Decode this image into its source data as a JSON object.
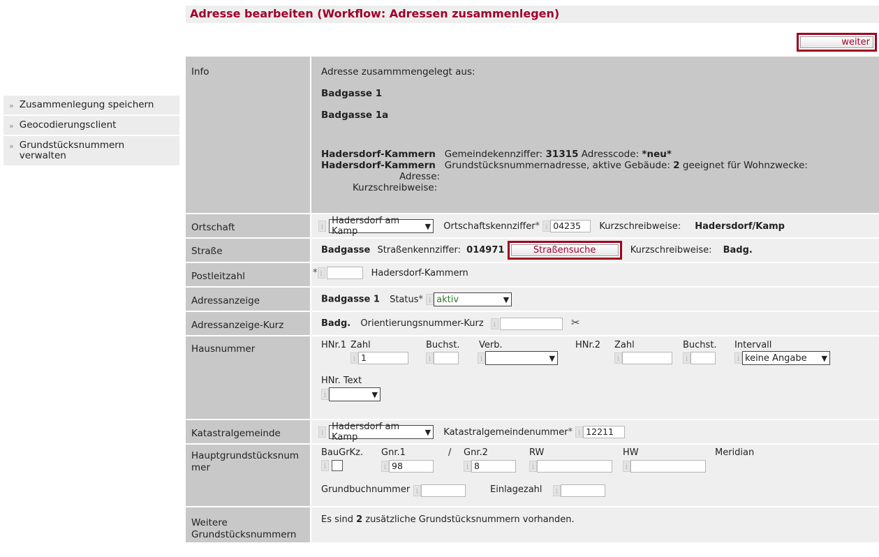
{
  "sidebar": {
    "items": [
      {
        "label": "Zusammenlegung speichern"
      },
      {
        "label": "Geocodierungsclient"
      },
      {
        "label": "Grundstücksnummern verwalten"
      }
    ]
  },
  "title": "Adresse bearbeiten (Workflow: Adressen zusammenlegen)",
  "weiter_label": "weiter",
  "info": {
    "label": "Info",
    "merged_from": "Adresse zusammmengelegt aus:",
    "addr1": "Badgasse 1",
    "addr2": "Badgasse 1a",
    "line1_name": "Hadersdorf-Kammern",
    "line1_text1": "Gemeindekennziffer:",
    "line1_code": "31315",
    "line1_text2": "Adresscode:",
    "line1_adresscode": "*neu*",
    "line2_name": "Hadersdorf-Kammern",
    "line2_text1": "Grundstücksnummernadresse, aktive Gebäude:",
    "line2_count": "2",
    "line2_text2": "geeignet für Wohnzwecke:",
    "adresse_label": "Adresse:",
    "kurz_label": "Kurzschreibweise:"
  },
  "ortschaft": {
    "label": "Ortschaft",
    "select": "Hadersdorf am Kamp",
    "kennziffer_label": "Ortschaftskennziffer",
    "kennziffer_value": "04235",
    "kurz_label": "Kurzschreibweise:",
    "kurz_value": "Hadersdorf/Kamp"
  },
  "strasse": {
    "label": "Straße",
    "name": "Badgasse",
    "kennziffer_label": "Straßenkennziffer:",
    "kennziffer_value": "014971",
    "button": "Straßensuche",
    "kurz_label": "Kurzschreibweise:",
    "kurz_value": "Badg."
  },
  "plz": {
    "label": "Postleitzahl",
    "value": "",
    "ort": "Hadersdorf-Kammern"
  },
  "adressanzeige": {
    "label": "Adressanzeige",
    "value": "Badgasse 1",
    "status_label": "Status",
    "status_value": "aktiv"
  },
  "adressanzeige_kurz": {
    "label": "Adressanzeige-Kurz",
    "value": "Badg.",
    "on_kurz_label": "Orientierungsnummer-Kurz",
    "on_kurz_value": ""
  },
  "hausnummer": {
    "label": "Hausnummer",
    "hnr1": "HNr.1",
    "zahl": "Zahl",
    "zahl_value": "1",
    "buchst": "Buchst.",
    "verb": "Verb.",
    "hnr2": "HNr.2",
    "zahl2": "Zahl",
    "buchst2": "Buchst.",
    "intervall": "Intervall",
    "intervall_value": "keine Angabe",
    "hnr_text": "HNr. Text"
  },
  "katastral": {
    "label": "Katastralgemeinde",
    "select": "Hadersdorf am Kamp",
    "nummer_label": "Katastralgemeindenummer",
    "nummer_value": "12211"
  },
  "hauptgrund": {
    "label": "Hauptgrundstücksnummer",
    "baugrkz": "BauGrKz.",
    "gnr1": "Gnr.1",
    "slash": "/",
    "gnr2": "Gnr.2",
    "gnr1_value": "98",
    "gnr2_value": "8",
    "rw": "RW",
    "hw": "HW",
    "meridian": "Meridian",
    "grundbuch_label": "Grundbuchnummer",
    "einlage_label": "Einlagezahl"
  },
  "weitere": {
    "label": "Weitere Grundstücksnummern",
    "text1": "Es sind",
    "count": "2",
    "text2": "zusätzliche Grundstücksnummern vorhanden."
  },
  "colors": {
    "title": "#a0002a",
    "frame": "#a0001e",
    "label_bg": "#c8c8c8",
    "value_bg": "#efefef"
  }
}
